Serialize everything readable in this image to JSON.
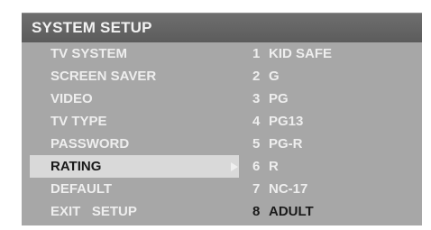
{
  "header": {
    "title": "SYSTEM SETUP"
  },
  "menu": {
    "items": [
      {
        "label": "TV SYSTEM",
        "option_num": "1",
        "option": "KID SAFE"
      },
      {
        "label": "SCREEN SAVER",
        "option_num": "2",
        "option": "G"
      },
      {
        "label": "VIDEO",
        "option_num": "3",
        "option": "PG"
      },
      {
        "label": "TV TYPE",
        "option_num": "4",
        "option": "PG13"
      },
      {
        "label": "PASSWORD",
        "option_num": "5",
        "option": "PG-R"
      },
      {
        "label": "RATING",
        "option_num": "6",
        "option": "R"
      },
      {
        "label": "DEFAULT",
        "option_num": "7",
        "option": "NC-17"
      },
      {
        "label": "EXIT   SETUP",
        "option_num": "8",
        "option": "ADULT"
      }
    ],
    "selected_item": "RATING",
    "current_option": "ADULT"
  },
  "colors": {
    "panel": "#a7a7a7",
    "header": "#5f5f5f",
    "text": "#eeeeee",
    "highlight": "#d9d9d9",
    "selected_text": "#1a1a1a"
  },
  "icons": {
    "submenu_arrow": "right-triangle-icon"
  }
}
